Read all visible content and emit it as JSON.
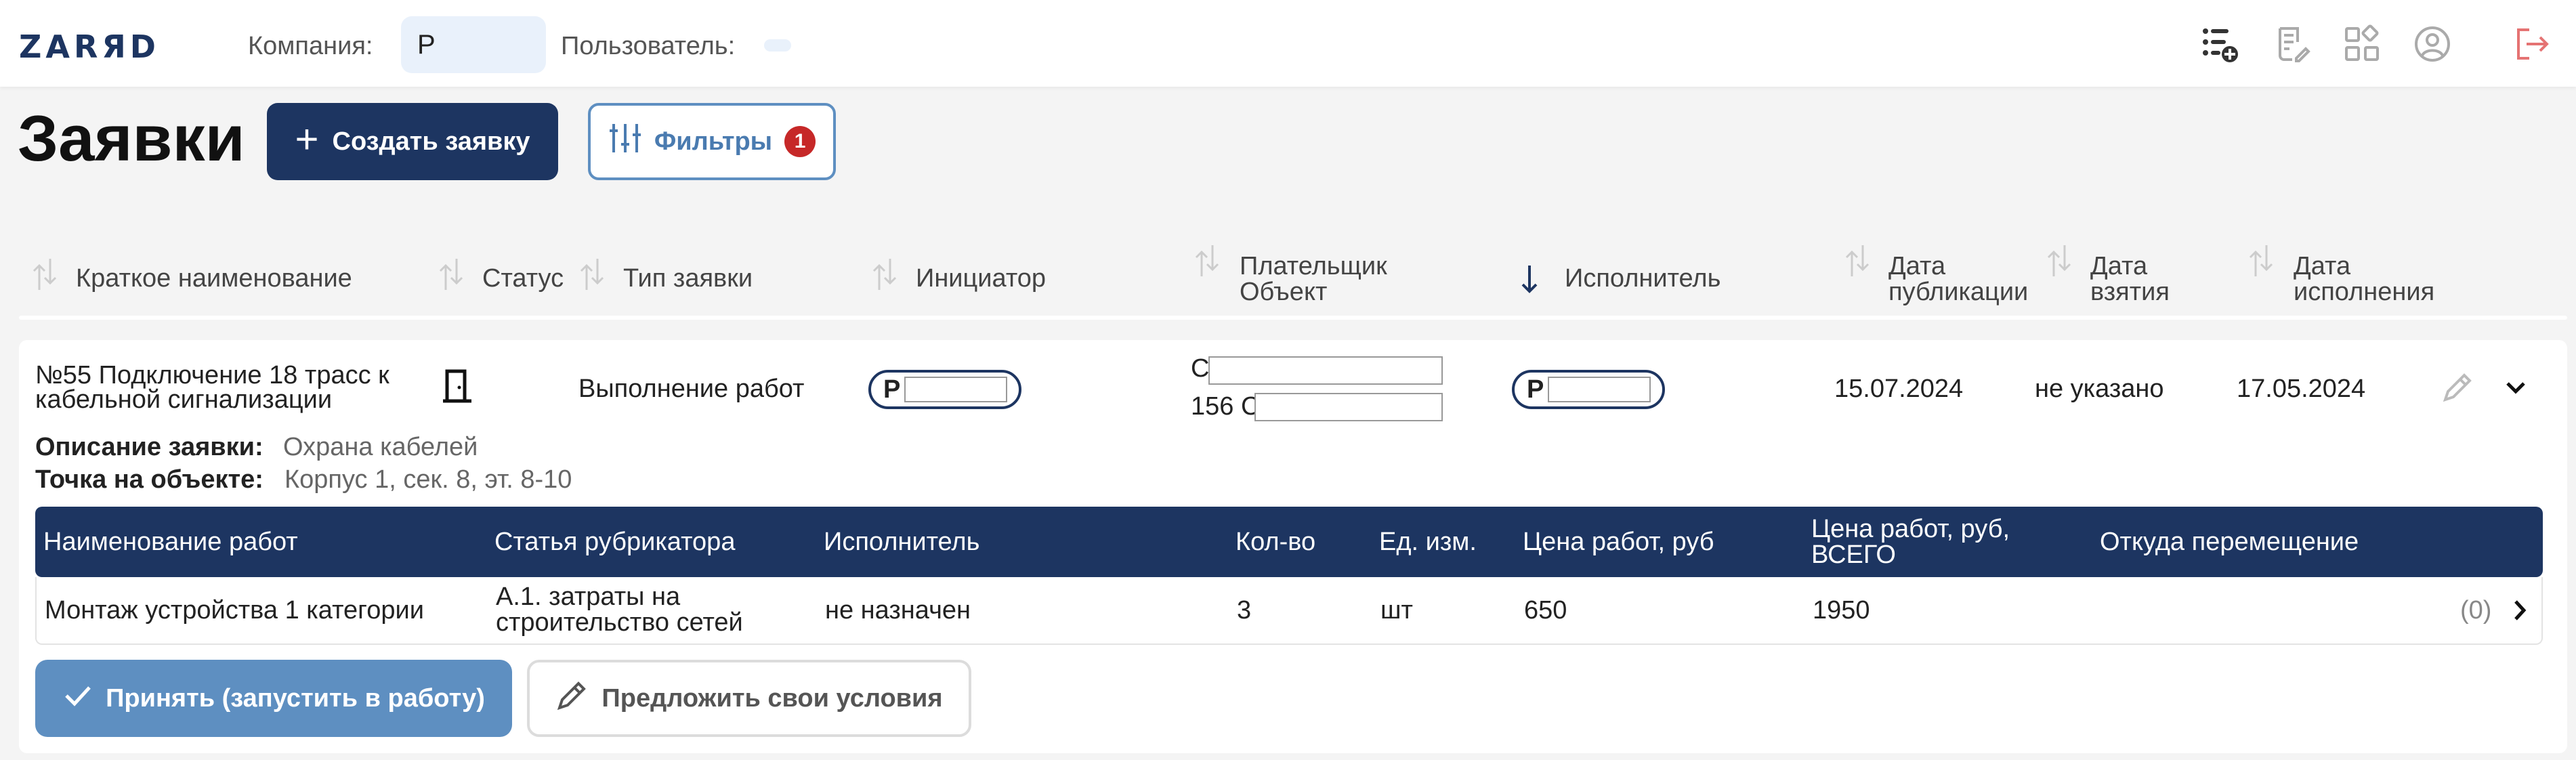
{
  "header": {
    "logo": "ZARЯD",
    "company_label": "Компания:",
    "company_value": "Р",
    "user_label": "Пользователь:"
  },
  "toolbar": {
    "title": "Заявки",
    "create_label": "Создать заявку",
    "filters_label": "Фильтры",
    "filters_count": "1"
  },
  "columns": {
    "short_name": "Краткое наименование",
    "status": "Статус",
    "type": "Тип заявки",
    "initiator": "Инициатор",
    "payer": "Плательщик",
    "object": "Объект",
    "executor": "Исполнитель",
    "pub_date_1": "Дата",
    "pub_date_2": "публикации",
    "take_date_1": "Дата",
    "take_date_2": "взятия",
    "exec_date_1": "Дата",
    "exec_date_2": "исполнения"
  },
  "request": {
    "title_line1": "№55 Подключение 18 трасс к",
    "title_line2": "кабельной сигнализации",
    "type": "Выполнение работ",
    "initiator_prefix": "Р",
    "payer_prefix": "С",
    "object_prefix": "156 С",
    "executor_prefix": "Р",
    "pub_date": "15.07.2024",
    "take_date": "не указано",
    "exec_date": "17.05.2024",
    "description_label": "Описание заявки:",
    "description_value": "Охрана кабелей",
    "point_label": "Точка на объекте:",
    "point_value": "Корпус 1, сек. 8, эт. 8-10"
  },
  "work_table": {
    "headers": {
      "name": "Наименование работ",
      "article": "Статья рубрикатора",
      "executor": "Исполнитель",
      "qty": "Кол-во",
      "unit": "Ед. изм.",
      "price": "Цена работ, руб",
      "total_1": "Цена работ, руб,",
      "total_2": "ВСЕГО",
      "from": "Откуда перемещение"
    },
    "rows": [
      {
        "name": "Монтаж устройства 1 категории",
        "article_1": "А.1. затраты на",
        "article_2": "строительство сетей",
        "executor": "не назначен",
        "qty": "3",
        "unit": "шт",
        "price": "650",
        "total": "1950",
        "from": "(0)"
      }
    ]
  },
  "actions": {
    "accept_label": "Принять (запустить в работу)",
    "offer_label": "Предложить свои условия"
  },
  "colors": {
    "primary": "#1d3561",
    "accent": "#5e8fc1",
    "badge": "#c62828",
    "logout": "#e57373"
  }
}
